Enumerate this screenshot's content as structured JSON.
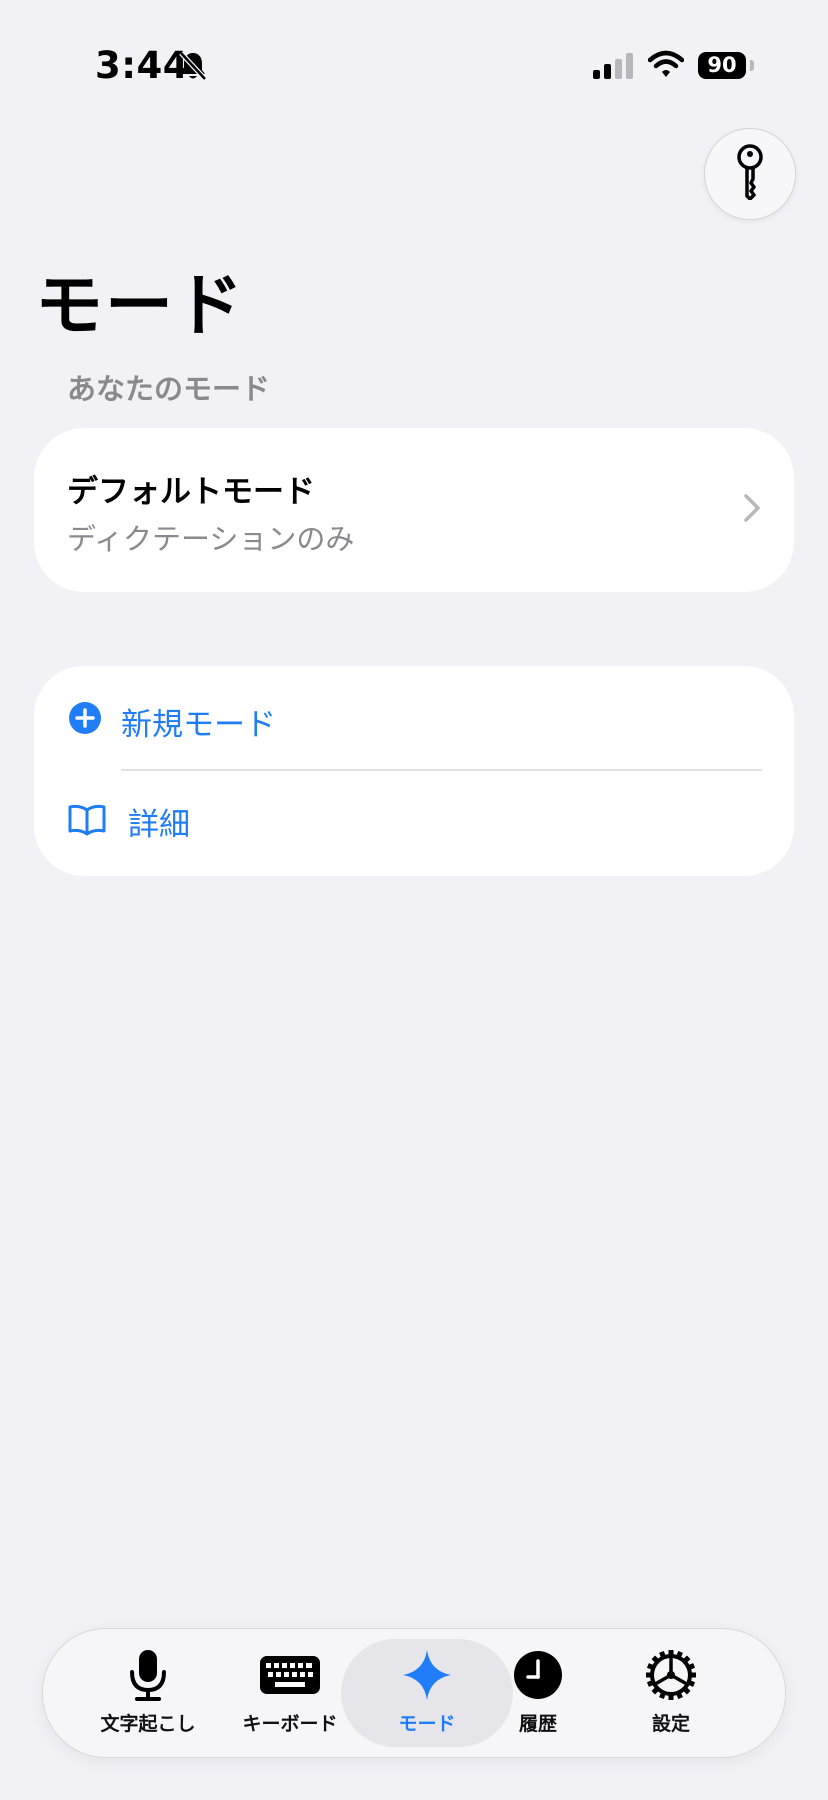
{
  "status_bar": {
    "time": "3:44",
    "battery": "90"
  },
  "header": {
    "title": "モード"
  },
  "section": {
    "header": "あなたのモード"
  },
  "default_mode": {
    "name": "デフォルトモード",
    "description": "ディクテーションのみ"
  },
  "actions": {
    "new_mode": "新規モード",
    "details": "詳細"
  },
  "tabs": [
    {
      "label": "文字起こし",
      "icon": "microphone-icon"
    },
    {
      "label": "キーボード",
      "icon": "keyboard-icon"
    },
    {
      "label": "モード",
      "icon": "sparkle-icon",
      "active": true
    },
    {
      "label": "履歴",
      "icon": "clock-icon"
    },
    {
      "label": "設定",
      "icon": "gear-icon"
    }
  ],
  "colors": {
    "accent": "#1f7ef7",
    "background": "#f2f1f6",
    "secondary_text": "#8a8a8e"
  }
}
